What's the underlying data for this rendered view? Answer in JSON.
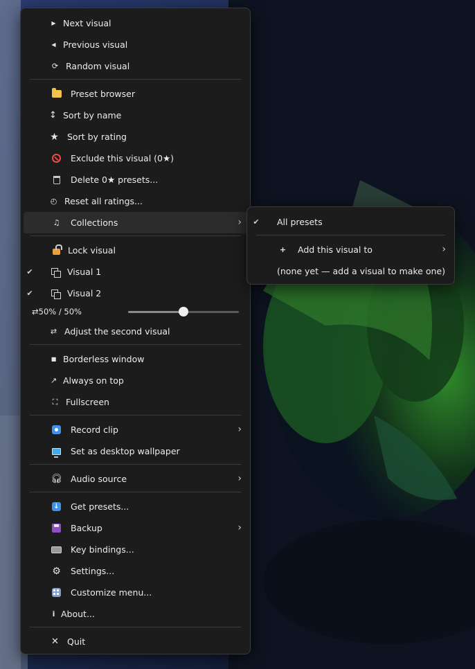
{
  "main_menu": {
    "next_visual": "Next visual",
    "previous_visual": "Previous visual",
    "random_visual": "Random visual",
    "preset_browser": "Preset browser",
    "sort_by_name": "Sort by name",
    "sort_by_rating": "Sort by rating",
    "exclude_visual": "Exclude this visual (0★)",
    "delete_presets": "Delete 0★ presets...",
    "reset_ratings": "Reset all ratings...",
    "collections": "Collections",
    "lock_visual": "Lock visual",
    "visual_1": "Visual 1",
    "visual_2": "Visual 2",
    "mix_readout": "50%  /  50%",
    "mix_fraction": 0.5,
    "adjust_second": "Adjust the second visual",
    "borderless": "Borderless window",
    "always_on_top": "Always on top",
    "fullscreen": "Fullscreen",
    "record_clip": "Record clip",
    "set_wallpaper": "Set as desktop wallpaper",
    "audio_source": "Audio source",
    "get_presets": "Get presets...",
    "backup": "Backup",
    "key_bindings": "Key bindings...",
    "settings": "Settings...",
    "customize_menu": "Customize menu...",
    "about": "About...",
    "quit": "Quit"
  },
  "collections_submenu": {
    "all_presets": "All presets",
    "add_visual_to": "Add this visual to",
    "none_yet": "(none yet — add a visual to make one)"
  },
  "checked": {
    "visual_1": true,
    "visual_2": true,
    "all_presets": true
  },
  "icons": {
    "next": "play-icon",
    "previous": "back-icon",
    "random": "refresh-icon",
    "preset_browser": "folder-icon",
    "sort_name": "updown-arrow-icon",
    "sort_rating": "star-icon",
    "exclude": "no-entry-icon",
    "delete": "trash-icon",
    "reset": "timer-icon",
    "collections": "music-note-icon",
    "lock": "lock-icon",
    "visual": "windows-icon",
    "swap": "swap-icon",
    "borderless": "square-icon",
    "on_top": "pin-icon",
    "fullscreen": "expand-icon",
    "record": "record-icon",
    "wallpaper": "monitor-icon",
    "audio": "headphones-icon",
    "get_presets": "download-icon",
    "backup": "floppy-icon",
    "keybindings": "keyboard-icon",
    "settings": "gear-icon",
    "customize": "grid-icon",
    "about": "info-icon",
    "quit": "close-icon"
  },
  "colors": {
    "menu_bg": "#1c1c1c",
    "highlight": "#2c2c2c",
    "border": "#3a3a3a"
  }
}
